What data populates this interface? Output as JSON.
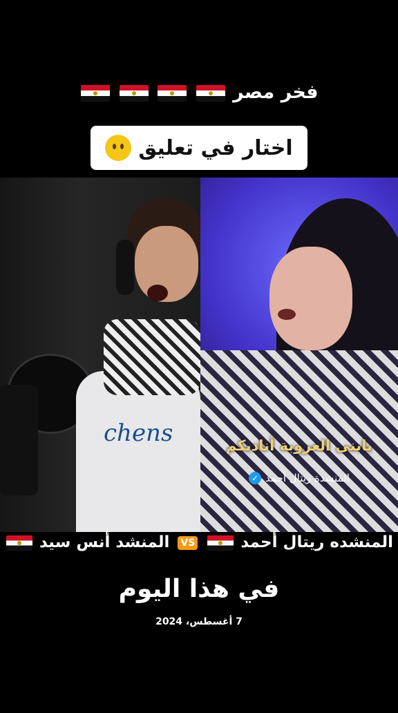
{
  "header": {
    "title": "فخر مصر",
    "flags": [
      "egypt-flag",
      "egypt-flag",
      "egypt-flag",
      "egypt-flag"
    ],
    "comment_prompt": "اختار في تعليق",
    "comment_emoji": "neutral-face-emoji"
  },
  "video": {
    "right_caption_main": "يابنى العروبة أناديكم",
    "right_caption_sub": "المنشدة ريتال أحمد",
    "verified_mark": "✓",
    "shirt_text": "chens"
  },
  "versus": {
    "right_name": "المنشده ريتال أحمد",
    "vs_label": "VS",
    "left_name": "المنشد أنس سيد"
  },
  "memory": {
    "title": "في هذا اليوم",
    "date": "7 أغسطس، 2024"
  },
  "colors": {
    "background": "#000000",
    "flag_red": "#ce1126",
    "vs_orange": "#f59a17",
    "caption_gold": "#f0d078",
    "verified_blue": "#1d9bf0"
  }
}
